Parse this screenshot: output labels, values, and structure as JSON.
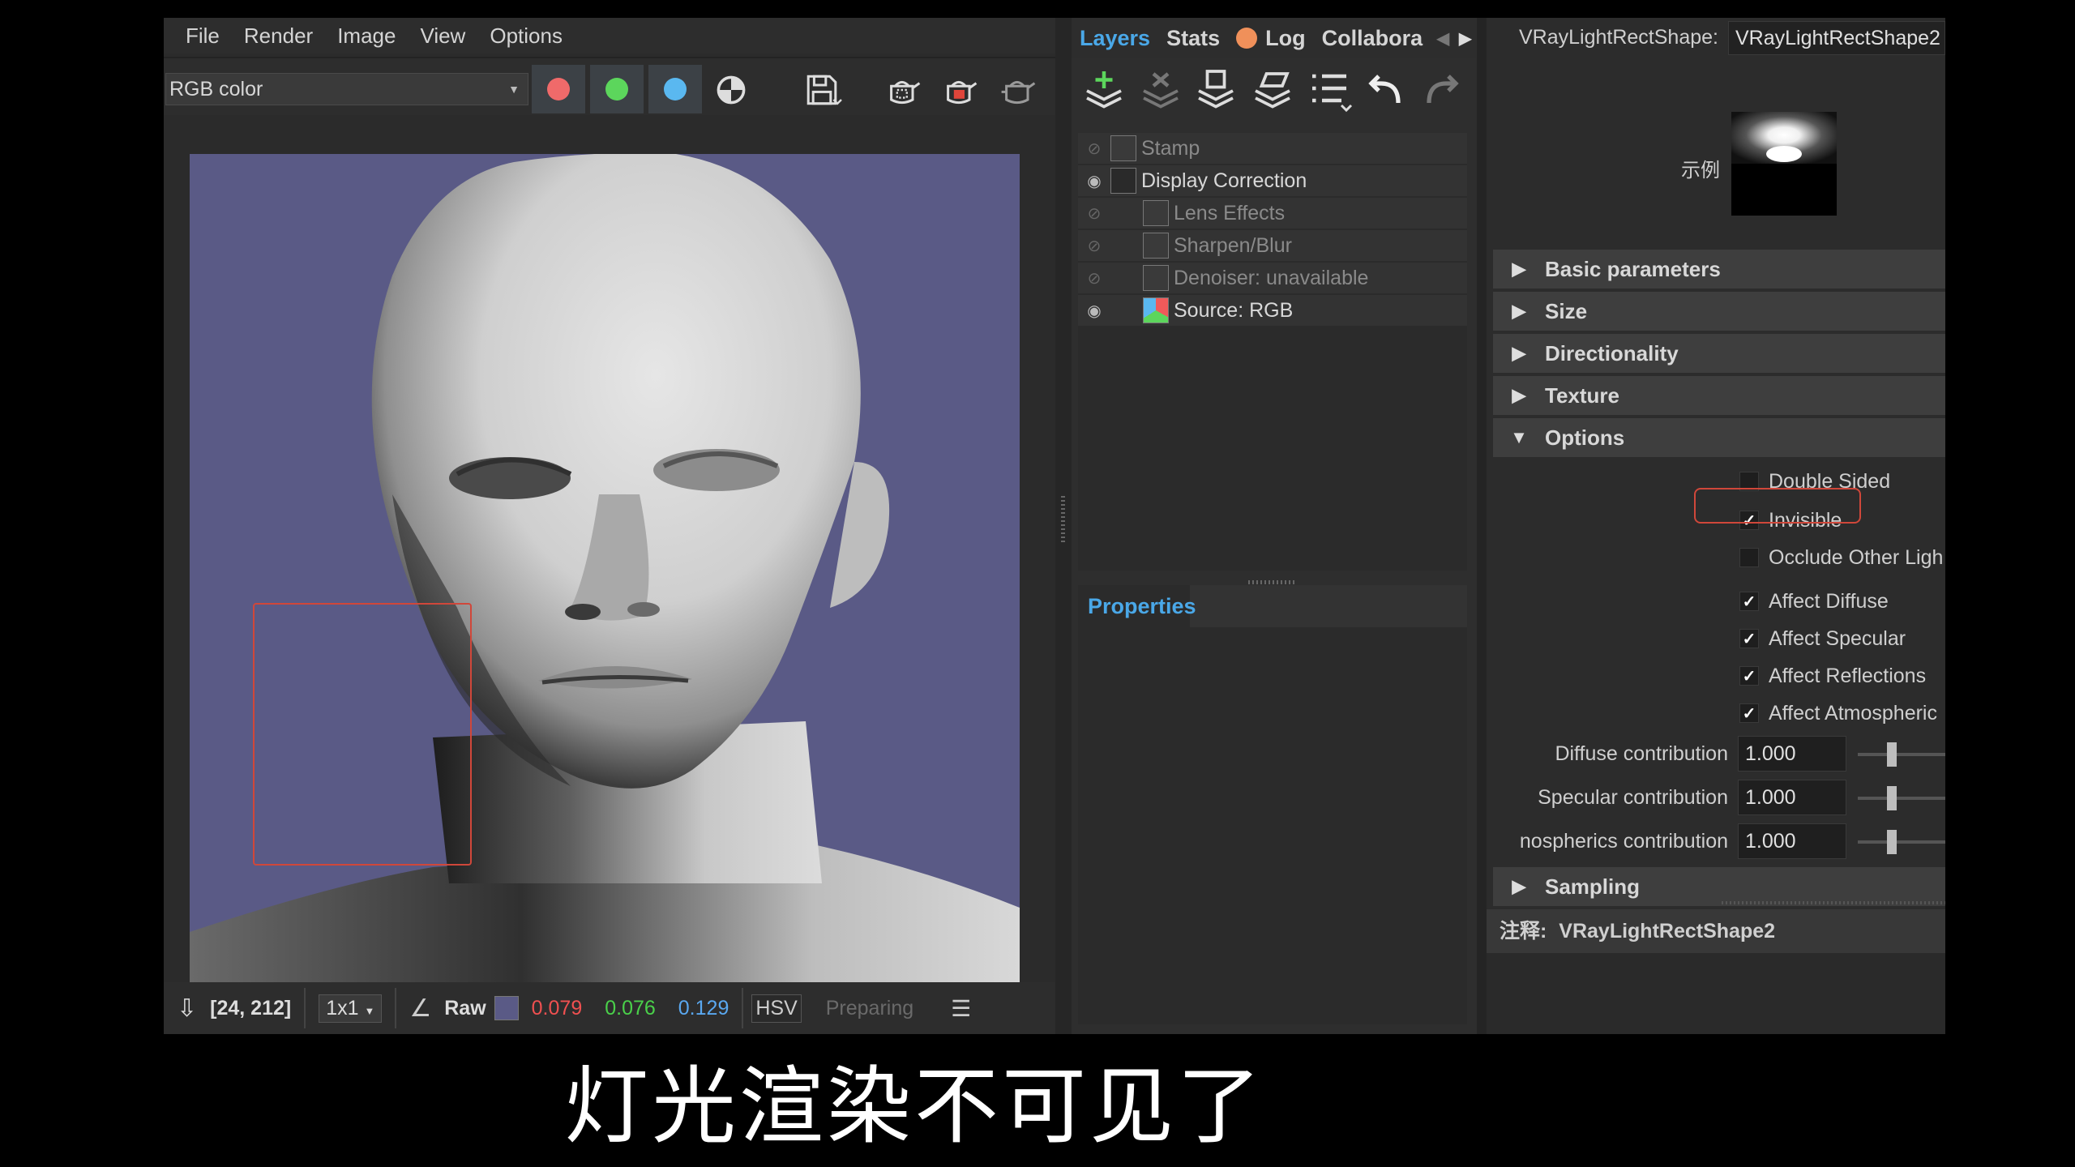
{
  "menu": [
    "File",
    "Render",
    "Image",
    "View",
    "Options"
  ],
  "toolbar": {
    "channel_value": "RGB color",
    "channel_colors": [
      "#f06a6a",
      "#5cd65c",
      "#5ab8f0"
    ]
  },
  "status": {
    "coords": "[24, 212]",
    "zoom": "1x1",
    "raw_label": "Raw",
    "raw_swatch": "#5a5a86",
    "r": "0.079",
    "g": "0.076",
    "b": "0.129",
    "r_color": "#f05050",
    "g_color": "#4ad04a",
    "b_color": "#5aa8f0",
    "hsv": "HSV",
    "state": "Preparing"
  },
  "layers_panel": {
    "tabs": [
      "Layers",
      "Stats",
      "Log",
      "Collabora"
    ],
    "log_dot_color": "#f0905a",
    "items": [
      {
        "name": "Stamp",
        "visible": false,
        "indent": 0
      },
      {
        "name": "Display Correction",
        "visible": true,
        "indent": 0
      },
      {
        "name": "Lens Effects",
        "visible": false,
        "indent": 1
      },
      {
        "name": "Sharpen/Blur",
        "visible": false,
        "indent": 1
      },
      {
        "name": "Denoiser: unavailable",
        "visible": false,
        "indent": 1
      },
      {
        "name": "Source: RGB",
        "visible": true,
        "indent": 1
      }
    ],
    "properties_tab": "Properties"
  },
  "attr": {
    "node_type_label": "VRayLightRectShape:",
    "node_name": "VRayLightRectShape2",
    "swatch_label": "示例",
    "sections": {
      "basic": "Basic parameters",
      "size": "Size",
      "directionality": "Directionality",
      "texture": "Texture",
      "options": "Options",
      "sampling": "Sampling"
    },
    "options": [
      {
        "label": "Double Sided",
        "checked": false
      },
      {
        "label": "Invisible",
        "checked": true
      },
      {
        "label": "Occlude Other Ligh",
        "checked": false
      },
      {
        "label": "Affect Diffuse",
        "checked": true
      },
      {
        "label": "Affect Specular",
        "checked": true
      },
      {
        "label": "Affect Reflections",
        "checked": true
      },
      {
        "label": "Affect Atmospheric",
        "checked": true
      }
    ],
    "contributions": [
      {
        "label": "Diffuse contribution",
        "value": "1.000"
      },
      {
        "label": "Specular contribution",
        "value": "1.000"
      },
      {
        "label": "nospherics contribution",
        "value": "1.000"
      }
    ],
    "notes_label": "注释:",
    "notes_value": "VRayLightRectShape2"
  },
  "subtitle": "灯光渲染不可见了"
}
